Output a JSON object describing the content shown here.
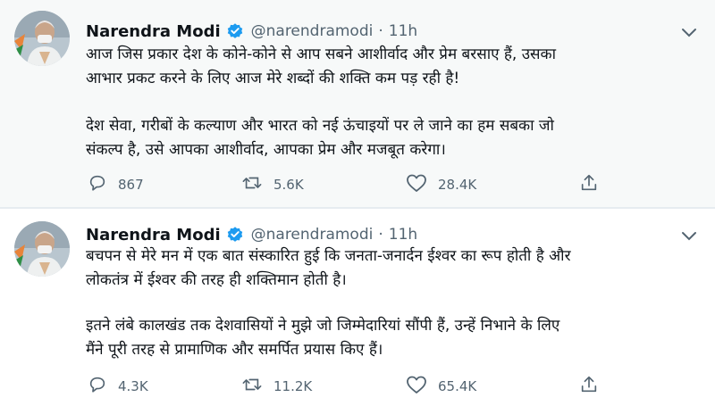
{
  "tweets": [
    {
      "author_name": "Narendra Modi",
      "handle": "@narendramodi",
      "separator": "·",
      "time": "11h",
      "para1": [
        "आज जिस प्रकार देश के कोने-कोने से आप सबने आशीर्वाद और प्रेम बरसाए हैं, उसका",
        "आभार प्रकट करने के लिए आज मेरे शब्दों की शक्ति कम पड़ रही है!"
      ],
      "para2": [
        "देश सेवा, गरीबों के कल्याण और भारत को नई ऊंचाइयों पर ले जाने का हम सबका जो",
        "संकल्प है, उसे आपका आशीर्वाद, आपका प्रेम और मजबूत करेगा।"
      ],
      "replies": "867",
      "retweets": "5.6K",
      "likes": "28.4K"
    },
    {
      "author_name": "Narendra Modi",
      "handle": "@narendramodi",
      "separator": "·",
      "time": "11h",
      "para1": [
        "बचपन से मेरे मन में एक बात संस्कारित हुई कि जनता-जनार्दन ईश्वर का रूप होती है और",
        "लोकतंत्र में ईश्वर की तरह ही शक्तिमान होती है।"
      ],
      "para2": [
        "इतने लंबे कालखंड तक देशवासियों ने मुझे जो जिम्मेदारियां सौंपी हैं, उन्हें निभाने के लिए",
        "मैंने पूरी तरह से प्रामाणिक और समर्पित प्रयास किए हैं।"
      ],
      "replies": "4.3K",
      "retweets": "11.2K",
      "likes": "65.4K"
    }
  ],
  "icons": {
    "reply": "reply-icon",
    "retweet": "retweet-icon",
    "like": "like-icon",
    "share": "share-icon",
    "verified": "verified-badge-icon",
    "more": "chevron-down-icon"
  },
  "colors": {
    "verified": "#1d9bf0",
    "secondary_text": "#536471",
    "highlight_bg": "#f7f9f9"
  }
}
